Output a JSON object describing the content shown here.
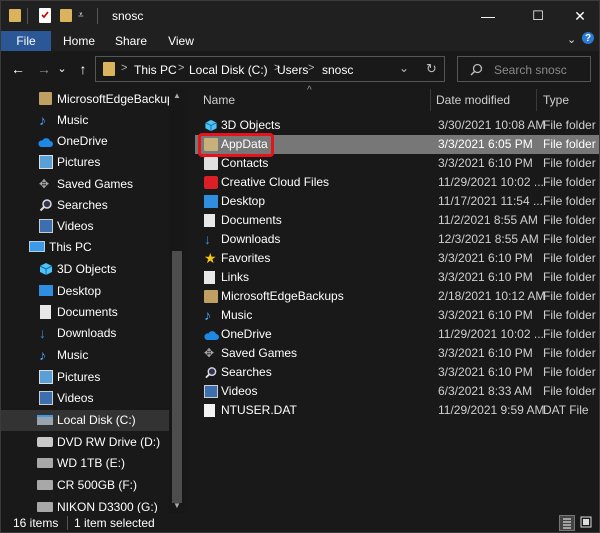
{
  "window": {
    "title": "snosc",
    "controls": {
      "minimize": "—",
      "maximize": "☐",
      "close": "✕"
    }
  },
  "ribbon": {
    "tabs": [
      "File",
      "Home",
      "Share",
      "View"
    ],
    "expand": "⌄",
    "help": "?"
  },
  "nav": {
    "back": "←",
    "forward": "→",
    "recent": "⌄",
    "up": "↑",
    "breadcrumb": [
      "This PC",
      "Local Disk (C:)",
      "Users",
      "snosc"
    ],
    "separator": ">",
    "address_dropdown": "⌄",
    "refresh": "↻",
    "search_placeholder": "Search snosc"
  },
  "sidebar": {
    "items": [
      {
        "label": "MicrosoftEdgeBackups",
        "icon": "folder-icon"
      },
      {
        "label": "Music",
        "icon": "music-icon"
      },
      {
        "label": "OneDrive",
        "icon": "cloud-icon"
      },
      {
        "label": "Pictures",
        "icon": "pictures-icon"
      },
      {
        "label": "Saved Games",
        "icon": "saved-games-icon"
      },
      {
        "label": "Searches",
        "icon": "search-icon"
      },
      {
        "label": "Videos",
        "icon": "videos-icon"
      },
      {
        "label": "This PC",
        "icon": "computer-icon"
      },
      {
        "label": "3D Objects",
        "icon": "3d-objects-icon"
      },
      {
        "label": "Desktop",
        "icon": "desktop-icon"
      },
      {
        "label": "Documents",
        "icon": "documents-icon"
      },
      {
        "label": "Downloads",
        "icon": "downloads-icon"
      },
      {
        "label": "Music",
        "icon": "music-icon"
      },
      {
        "label": "Pictures",
        "icon": "pictures-icon"
      },
      {
        "label": "Videos",
        "icon": "videos-icon"
      },
      {
        "label": "Local Disk (C:)",
        "icon": "drive-icon",
        "selected": true
      },
      {
        "label": "DVD RW Drive (D:)",
        "icon": "dvd-drive-icon"
      },
      {
        "label": "WD 1TB (E:)",
        "icon": "usb-drive-icon"
      },
      {
        "label": "CR 500GB (F:)",
        "icon": "usb-drive-icon"
      },
      {
        "label": "NIKON D3300 (G:)",
        "icon": "usb-drive-icon"
      }
    ]
  },
  "columns": {
    "name": "Name",
    "date": "Date modified",
    "type": "Type"
  },
  "files": [
    {
      "name": "3D Objects",
      "date": "3/30/2021 10:08 AM",
      "type": "File folder",
      "icon": "3d-objects-icon"
    },
    {
      "name": "AppData",
      "date": "3/3/2021 6:05 PM",
      "type": "File folder",
      "icon": "folder-icon",
      "selected": true
    },
    {
      "name": "Contacts",
      "date": "3/3/2021 6:10 PM",
      "type": "File folder",
      "icon": "contacts-icon"
    },
    {
      "name": "Creative Cloud Files",
      "date": "11/29/2021 10:02 ...",
      "type": "File folder",
      "icon": "creative-cloud-icon"
    },
    {
      "name": "Desktop",
      "date": "11/17/2021 11:54 ...",
      "type": "File folder",
      "icon": "desktop-icon"
    },
    {
      "name": "Documents",
      "date": "11/2/2021 8:55 AM",
      "type": "File folder",
      "icon": "documents-icon"
    },
    {
      "name": "Downloads",
      "date": "12/3/2021 8:55 AM",
      "type": "File folder",
      "icon": "downloads-icon"
    },
    {
      "name": "Favorites",
      "date": "3/3/2021 6:10 PM",
      "type": "File folder",
      "icon": "star-icon"
    },
    {
      "name": "Links",
      "date": "3/3/2021 6:10 PM",
      "type": "File folder",
      "icon": "links-icon"
    },
    {
      "name": "MicrosoftEdgeBackups",
      "date": "2/18/2021 10:12 AM",
      "type": "File folder",
      "icon": "folder-icon"
    },
    {
      "name": "Music",
      "date": "3/3/2021 6:10 PM",
      "type": "File folder",
      "icon": "music-icon"
    },
    {
      "name": "OneDrive",
      "date": "11/29/2021 10:02 ...",
      "type": "File folder",
      "icon": "cloud-icon"
    },
    {
      "name": "Saved Games",
      "date": "3/3/2021 6:10 PM",
      "type": "File folder",
      "icon": "saved-games-icon"
    },
    {
      "name": "Searches",
      "date": "3/3/2021 6:10 PM",
      "type": "File folder",
      "icon": "search-icon"
    },
    {
      "name": "Videos",
      "date": "6/3/2021 8:33 AM",
      "type": "File folder",
      "icon": "videos-icon"
    },
    {
      "name": "NTUSER.DAT",
      "date": "11/29/2021 9:59 AM",
      "type": "DAT File",
      "icon": "file-icon"
    }
  ],
  "status": {
    "count": "16 items",
    "selected": "1 item selected"
  },
  "colors": {
    "accent": "#2b5797",
    "highlight": "#e8121b",
    "selected_row": "#777777",
    "folder": "#d9b45c"
  }
}
